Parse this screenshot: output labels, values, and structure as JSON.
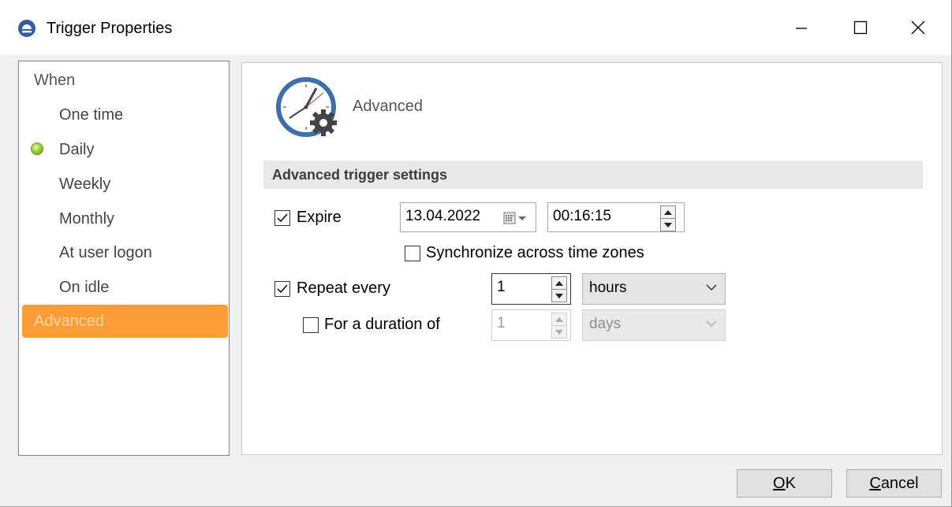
{
  "window": {
    "title": "Trigger Properties",
    "controls": [
      "minimize",
      "maximize",
      "close"
    ]
  },
  "nav": {
    "heading": "When",
    "items": [
      {
        "label": "One time",
        "active": false
      },
      {
        "label": "Daily",
        "active": true,
        "indicator": "green-dot-icon"
      },
      {
        "label": "Weekly",
        "active": false
      },
      {
        "label": "Monthly",
        "active": false
      },
      {
        "label": "At user logon",
        "active": false
      },
      {
        "label": "On idle",
        "active": false
      },
      {
        "label": "Advanced",
        "selected": true
      }
    ]
  },
  "page": {
    "title": "Advanced",
    "icon": "clock-gear-icon",
    "section_title": "Advanced trigger settings"
  },
  "settings": {
    "expire": {
      "label": "Expire",
      "checked": true,
      "date": "13.04.2022",
      "time": "00:16:15"
    },
    "sync_time_zones": {
      "label": "Synchronize across time zones",
      "checked": false
    },
    "repeat_every": {
      "label": "Repeat every",
      "checked": true,
      "value": "1",
      "unit": "hours"
    },
    "duration": {
      "label": "For a duration of",
      "checked": false,
      "value": "1",
      "unit": "days",
      "disabled": true
    }
  },
  "buttons": {
    "ok": {
      "mnemonic": "O",
      "rest": "K"
    },
    "cancel": {
      "mnemonic": "C",
      "rest": "ancel"
    }
  },
  "colors": {
    "selected_bg": "#fd9c35",
    "indicator_green": "#7fb82a",
    "icon_blue": "#3d6fa8"
  }
}
